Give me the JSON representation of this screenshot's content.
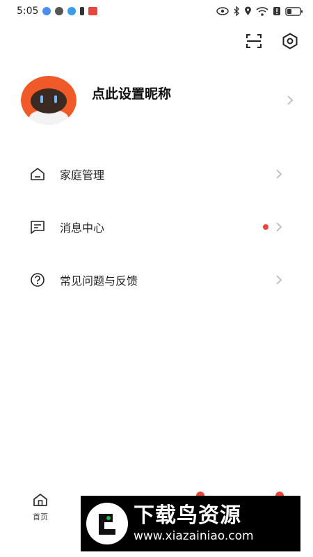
{
  "status": {
    "time": "5:05"
  },
  "profile": {
    "nickname": "点此设置昵称"
  },
  "menu": [
    {
      "label": "家庭管理",
      "icon": "home-icon"
    },
    {
      "label": "消息中心",
      "icon": "message-icon",
      "badge": true
    },
    {
      "label": "常见问题与反馈",
      "icon": "help-icon"
    }
  ],
  "tabbar": {
    "home_label": "首页"
  },
  "banner": {
    "title": "下载鸟资源",
    "url": "www.xiazainiao.com"
  },
  "colors": {
    "accent": "#f05a28",
    "badge": "#e8453c"
  }
}
